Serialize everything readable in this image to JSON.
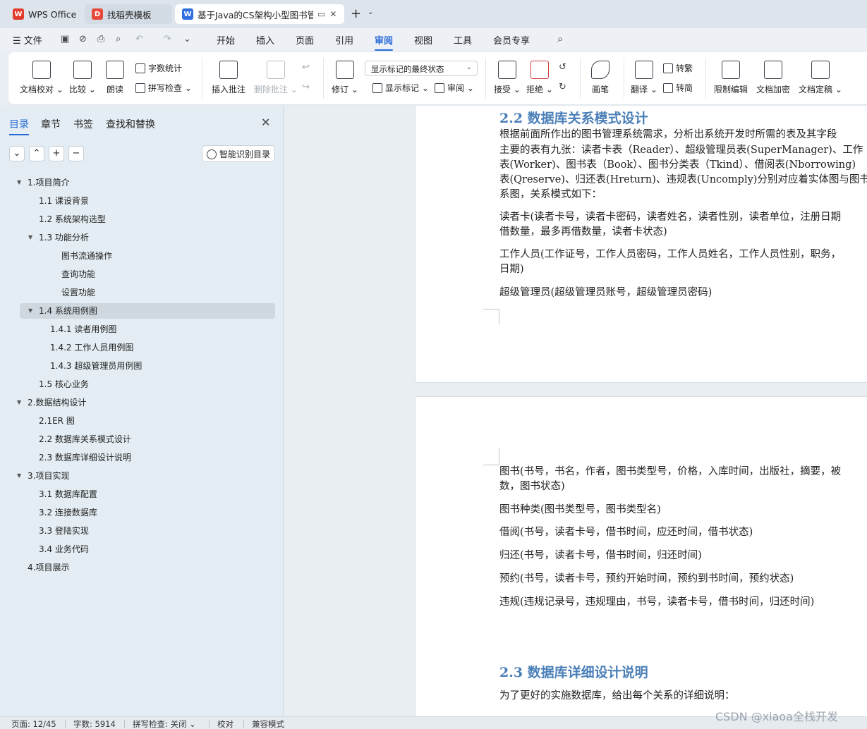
{
  "tabs": [
    {
      "label": "WPS Office",
      "icon": "wps-logo-icon"
    },
    {
      "label": "找稻壳模板",
      "icon": "docer-icon"
    },
    {
      "label": "基于Java的CS架构小型图书管",
      "icon": "word-doc-icon"
    }
  ],
  "menu": {
    "file": "文件",
    "items": [
      "开始",
      "插入",
      "页面",
      "引用",
      "审阅",
      "视图",
      "工具",
      "会员专享"
    ],
    "active": "审阅"
  },
  "ribbon": {
    "doc_check": "文档校对",
    "compare": "比较",
    "read_aloud": "朗读",
    "word_count": "字数统计",
    "spell_check": "拼写检查",
    "insert_comment": "插入批注",
    "delete_comment": "删除批注",
    "revise": "修订",
    "markup_select": "显示标记的最终状态",
    "show_markup": "显示标记",
    "review": "审阅",
    "accept": "接受",
    "reject": "拒绝",
    "pen": "画笔",
    "translate": "翻译",
    "to_traditional": "转繁",
    "to_simplified": "转简",
    "restrict_edit": "限制编辑",
    "encrypt": "文档加密",
    "finalize": "文档定稿"
  },
  "nav": {
    "tabs": [
      "目录",
      "章节",
      "书签",
      "查找和替换"
    ],
    "smart_toc": "智能识别目录",
    "toc": [
      {
        "label": "1.项目简介",
        "level": 1,
        "expanded": true
      },
      {
        "label": "1.1 课设背景",
        "level": 2
      },
      {
        "label": "1.2 系统架构选型",
        "level": 2
      },
      {
        "label": "1.3 功能分析",
        "level": 2,
        "expanded": true
      },
      {
        "label": "图书流通操作",
        "level": 4
      },
      {
        "label": "查询功能",
        "level": 4
      },
      {
        "label": "设置功能",
        "level": 4
      },
      {
        "label": "1.4 系统用例图",
        "level": 2,
        "expanded": true,
        "selected": true
      },
      {
        "label": "1.4.1 读者用例图",
        "level": 3
      },
      {
        "label": "1.4.2 工作人员用例图",
        "level": 3
      },
      {
        "label": "1.4.3 超级管理员用例图",
        "level": 3
      },
      {
        "label": "1.5 核心业务",
        "level": 2
      },
      {
        "label": "2.数据结构设计",
        "level": 1,
        "expanded": true
      },
      {
        "label": "2.1ER 图",
        "level": 2
      },
      {
        "label": "2.2 数据库关系模式设计",
        "level": 2
      },
      {
        "label": "2.3 数据库详细设计说明",
        "level": 2
      },
      {
        "label": "3.项目实现",
        "level": 1,
        "expanded": true
      },
      {
        "label": "3.1 数据库配置",
        "level": 2
      },
      {
        "label": "3.2 连接数据库",
        "level": 2
      },
      {
        "label": "3.3 登陆实现",
        "level": 2
      },
      {
        "label": "3.4 业务代码",
        "level": 2
      },
      {
        "label": "4.项目展示",
        "level": 1
      }
    ]
  },
  "document": {
    "page1": {
      "heading": "2.2 数据库关系模式设计",
      "lines": [
        "根据前面所作出的图书管理系统需求，分析出系统开发时所需的表及其字段",
        "主要的表有九张：读者卡表（Reader）、超级管理员表(SuperManager)、工作",
        "表(Worker)、图书表（Book）、图书分类表（Tkind）、借阅表(Nborrowing)",
        "表(Qreserve)、归还表(Hreturn)、违规表(Uncomply)分别对应着实体图与图书",
        "系图，关系模式如下：",
        "读者卡(读者卡号，读者卡密码，读者姓名，读者性别，读者单位，注册日期",
        "借数量，最多再借数量，读者卡状态)",
        "工作人员(工作证号，工作人员密码，工作人员姓名，工作人员性别，职务，",
        "日期)",
        "超级管理员(超级管理员账号，超级管理员密码)"
      ]
    },
    "page2": {
      "lines": [
        "图书(书号，书名，作者，图书类型号，价格，入库时间，出版社，摘要，被",
        "数，图书状态)",
        "图书种类(图书类型号，图书类型名)",
        "借阅(书号，读者卡号，借书时间，应还时间，借书状态)",
        "归还(书号，读者卡号，借书时间，归还时间)",
        "预约(书号，读者卡号，预约开始时间，预约到书时间，预约状态)",
        "违规(违规记录号，违规理由，书号，读者卡号，借书时间，归还时间)"
      ],
      "heading": "2.3 数据库详细设计说明",
      "after_heading": "为了更好的实施数据库，给出每个关系的详细说明："
    }
  },
  "status": {
    "page": "页面: 12/45",
    "words": "字数: 5914",
    "spell": "拼写检查: 关闭",
    "proof": "校对",
    "compat": "兼容模式"
  },
  "watermark": "CSDN @xiaoa全栈开发"
}
